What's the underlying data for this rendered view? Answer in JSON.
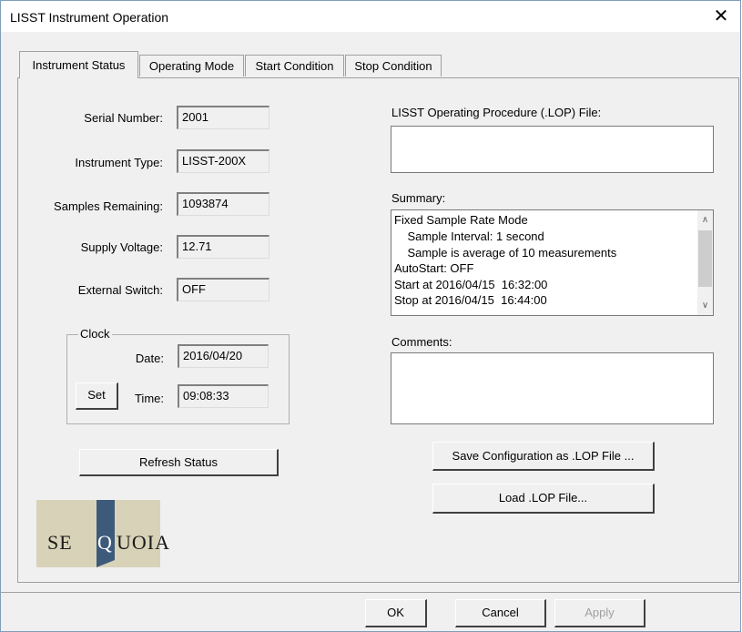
{
  "window": {
    "title": "LISST Instrument Operation",
    "close_glyph": "✕"
  },
  "tabs": [
    {
      "label": "Instrument Status",
      "active": true
    },
    {
      "label": "Operating Mode",
      "active": false
    },
    {
      "label": "Start Condition",
      "active": false
    },
    {
      "label": "Stop Condition",
      "active": false
    }
  ],
  "status": {
    "serial_label": "Serial Number:",
    "serial_value": "2001",
    "type_label": "Instrument Type:",
    "type_value": "LISST-200X",
    "samples_label": "Samples Remaining:",
    "samples_value": "1093874",
    "voltage_label": "Supply Voltage:",
    "voltage_value": "12.71",
    "switch_label": "External Switch:",
    "switch_value": "OFF"
  },
  "clock": {
    "title": "Clock",
    "date_label": "Date:",
    "date_value": "2016/04/20",
    "time_label": "Time:",
    "time_value": "09:08:33",
    "set_label": "Set"
  },
  "refresh_label": "Refresh Status",
  "logo": {
    "text_pre": "SE",
    "text_q": "Q",
    "text_post": "UOIA"
  },
  "lop": {
    "label": "LISST Operating Procedure (.LOP) File:",
    "value": ""
  },
  "summary": {
    "label": "Summary:",
    "lines": [
      "Fixed Sample Rate Mode",
      "    Sample Interval: 1 second",
      "    Sample is average of 10 measurements",
      "AutoStart: OFF",
      "Start at 2016/04/15  16:32:00",
      "Stop at 2016/04/15  16:44:00"
    ]
  },
  "comments": {
    "label": "Comments:",
    "value": ""
  },
  "buttons": {
    "save_lop": "Save Configuration as .LOP File ...",
    "load_lop": "Load .LOP File...",
    "ok": "OK",
    "cancel": "Cancel",
    "apply": "Apply"
  },
  "colors": {
    "dialog_bg": "#f0f0f0",
    "disabled_text": "#a0a0a0",
    "logo_bg": "#d8d3b8",
    "logo_q_bg": "#3d5a7a"
  }
}
